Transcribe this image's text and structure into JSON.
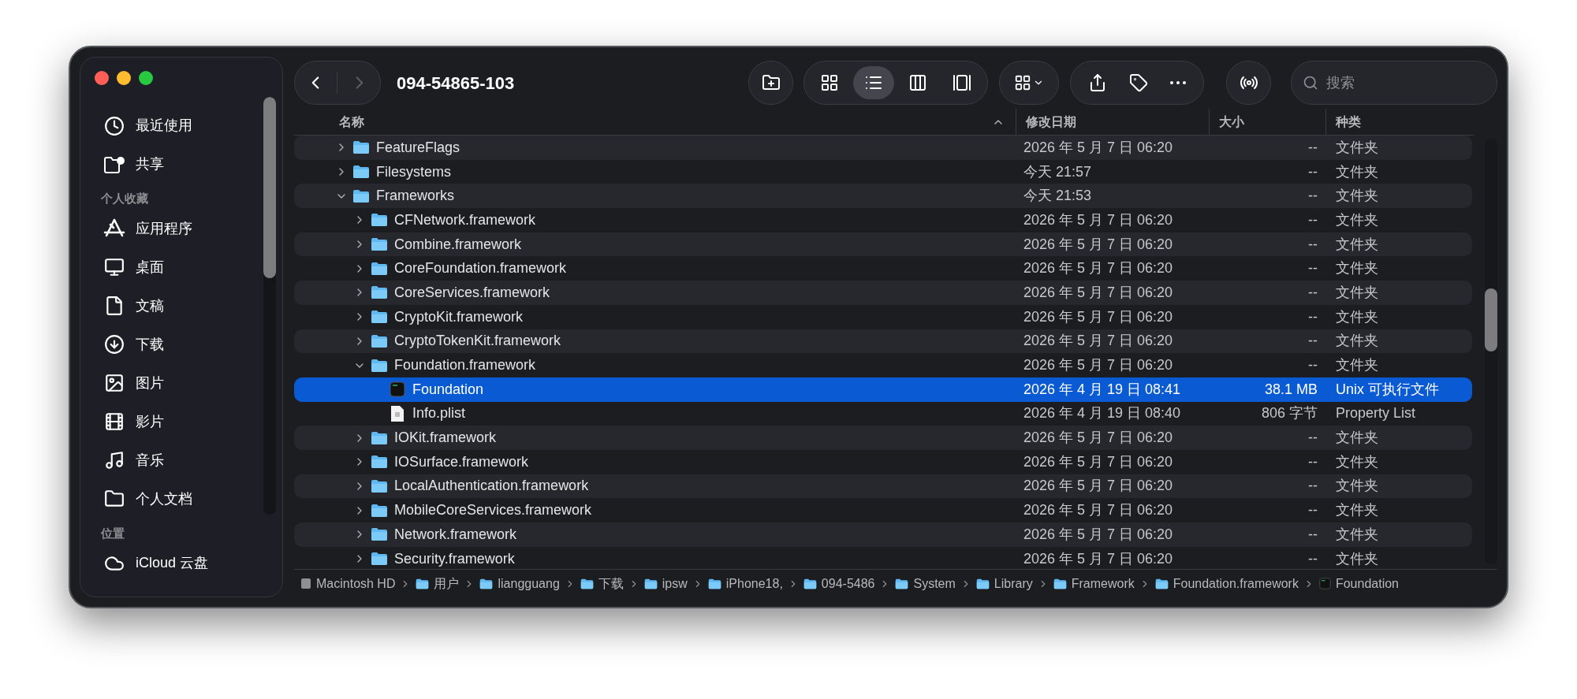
{
  "window": {
    "title": "094-54865-103",
    "back_enabled": true,
    "forward_enabled": false
  },
  "sidebar": {
    "sections": [
      {
        "items": [
          {
            "label": "最近使用",
            "kind": "recents",
            "selected": false
          },
          {
            "label": "共享",
            "kind": "shared",
            "selected": false
          }
        ]
      },
      {
        "heading": "个人收藏",
        "items": [
          {
            "label": "应用程序",
            "kind": "apps",
            "selected": false
          },
          {
            "label": "桌面",
            "kind": "desktop",
            "selected": false
          },
          {
            "label": "文稿",
            "kind": "document",
            "selected": false
          },
          {
            "label": "下载",
            "kind": "download",
            "selected": false
          },
          {
            "label": "图片",
            "kind": "photo",
            "selected": false
          },
          {
            "label": "影片",
            "kind": "film",
            "selected": false
          },
          {
            "label": "音乐",
            "kind": "music",
            "selected": false
          },
          {
            "label": "个人文档",
            "kind": "folder",
            "selected": false
          }
        ]
      },
      {
        "heading": "位置",
        "items": [
          {
            "label": "iCloud 云盘",
            "kind": "cloud",
            "selected": false
          }
        ]
      }
    ]
  },
  "toolbar": {
    "views": [
      {
        "kind": "icons",
        "selected": false
      },
      {
        "kind": "list",
        "selected": true
      },
      {
        "kind": "columns",
        "selected": false
      },
      {
        "kind": "gallery",
        "selected": false
      }
    ],
    "search": {
      "placeholder": "搜索"
    }
  },
  "table": {
    "columns": [
      {
        "label": "名称",
        "sorted": true
      },
      {
        "label": "修改日期",
        "sorted": false
      },
      {
        "label": "大小",
        "sorted": false
      },
      {
        "label": "种类",
        "sorted": false
      }
    ],
    "rows": [
      {
        "name": "FeatureFlags",
        "kind": "folder",
        "expanded": false,
        "selected": false,
        "date": "2026 年 5 月 7 日 06:20",
        "size": "--",
        "type": "文件夹"
      },
      {
        "name": "Filesystems",
        "kind": "folder",
        "expanded": false,
        "selected": false,
        "date": "今天 21:57",
        "size": "--",
        "type": "文件夹"
      },
      {
        "name": "Frameworks",
        "kind": "folder",
        "expanded": true,
        "selected": false,
        "date": "今天 21:53",
        "size": "--",
        "type": "文件夹",
        "children": [
          {
            "name": "CFNetwork.framework",
            "kind": "folder",
            "expanded": false,
            "selected": false,
            "date": "2026 年 5 月 7 日 06:20",
            "size": "--",
            "type": "文件夹"
          },
          {
            "name": "Combine.framework",
            "kind": "folder",
            "expanded": false,
            "selected": false,
            "date": "2026 年 5 月 7 日 06:20",
            "size": "--",
            "type": "文件夹"
          },
          {
            "name": "CoreFoundation.framework",
            "kind": "folder",
            "expanded": false,
            "selected": false,
            "date": "2026 年 5 月 7 日 06:20",
            "size": "--",
            "type": "文件夹"
          },
          {
            "name": "CoreServices.framework",
            "kind": "folder",
            "expanded": false,
            "selected": false,
            "date": "2026 年 5 月 7 日 06:20",
            "size": "--",
            "type": "文件夹"
          },
          {
            "name": "CryptoKit.framework",
            "kind": "folder",
            "expanded": false,
            "selected": false,
            "date": "2026 年 5 月 7 日 06:20",
            "size": "--",
            "type": "文件夹"
          },
          {
            "name": "CryptoTokenKit.framework",
            "kind": "folder",
            "expanded": false,
            "selected": false,
            "date": "2026 年 5 月 7 日 06:20",
            "size": "--",
            "type": "文件夹"
          },
          {
            "name": "Foundation.framework",
            "kind": "folder",
            "expanded": true,
            "selected": false,
            "date": "2026 年 5 月 7 日 06:20",
            "size": "--",
            "type": "文件夹",
            "children": [
              {
                "name": "Foundation",
                "kind": "executable",
                "selected": true,
                "date": "2026 年 4 月 19 日 08:41",
                "size": "38.1 MB",
                "type": "Unix 可执行文件"
              },
              {
                "name": "Info.plist",
                "kind": "document",
                "selected": false,
                "date": "2026 年 4 月 19 日 08:40",
                "size": "806 字节",
                "type": "Property List"
              }
            ]
          },
          {
            "name": "IOKit.framework",
            "kind": "folder",
            "expanded": false,
            "selected": false,
            "date": "2026 年 5 月 7 日 06:20",
            "size": "--",
            "type": "文件夹"
          },
          {
            "name": "IOSurface.framework",
            "kind": "folder",
            "expanded": false,
            "selected": false,
            "date": "2026 年 5 月 7 日 06:20",
            "size": "--",
            "type": "文件夹"
          },
          {
            "name": "LocalAuthentication.framework",
            "kind": "folder",
            "expanded": false,
            "selected": false,
            "date": "2026 年 5 月 7 日 06:20",
            "size": "--",
            "type": "文件夹"
          },
          {
            "name": "MobileCoreServices.framework",
            "kind": "folder",
            "expanded": false,
            "selected": false,
            "date": "2026 年 5 月 7 日 06:20",
            "size": "--",
            "type": "文件夹"
          },
          {
            "name": "Network.framework",
            "kind": "folder",
            "expanded": false,
            "selected": false,
            "date": "2026 年 5 月 7 日 06:20",
            "size": "--",
            "type": "文件夹"
          },
          {
            "name": "Security.framework",
            "kind": "folder",
            "expanded": false,
            "selected": false,
            "date": "2026 年 5 月 7 日 06:20",
            "size": "--",
            "type": "文件夹"
          }
        ]
      }
    ]
  },
  "path_bar": [
    {
      "label": "Macintosh HD",
      "kind": "disk"
    },
    {
      "label": "用户",
      "kind": "folder"
    },
    {
      "label": "liangguang",
      "kind": "folder"
    },
    {
      "label": "下载",
      "kind": "folder"
    },
    {
      "label": "ipsw",
      "kind": "folder"
    },
    {
      "label": "iPhone18,",
      "kind": "folder"
    },
    {
      "label": "094-5486",
      "kind": "folder"
    },
    {
      "label": "System",
      "kind": "folder"
    },
    {
      "label": "Library",
      "kind": "folder"
    },
    {
      "label": "Framework",
      "kind": "folder"
    },
    {
      "label": "Foundation.framework",
      "kind": "folder"
    },
    {
      "label": "Foundation",
      "kind": "executable"
    }
  ]
}
